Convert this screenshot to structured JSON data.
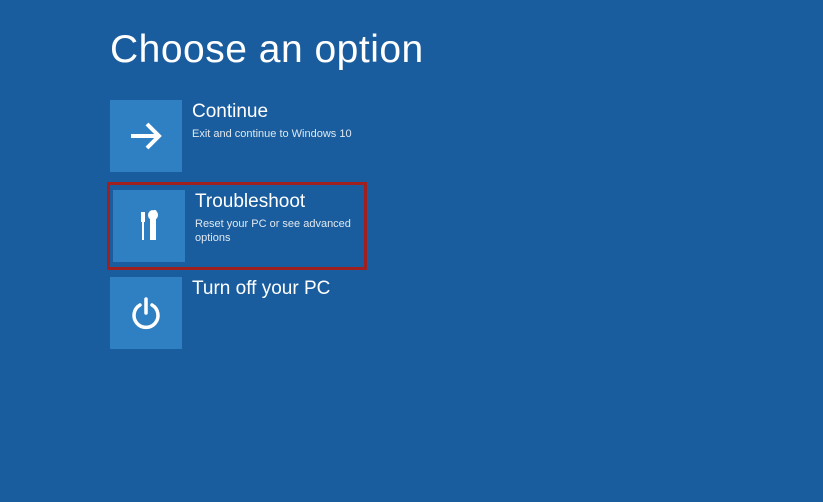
{
  "page": {
    "title": "Choose an option"
  },
  "options": [
    {
      "title": "Continue",
      "desc": "Exit and continue to Windows 10"
    },
    {
      "title": "Troubleshoot",
      "desc": "Reset your PC or see advanced options"
    },
    {
      "title": "Turn off your PC",
      "desc": ""
    }
  ],
  "colors": {
    "background": "#1a5d9e",
    "tile": "#2e80c2",
    "highlight": "#a02020"
  }
}
